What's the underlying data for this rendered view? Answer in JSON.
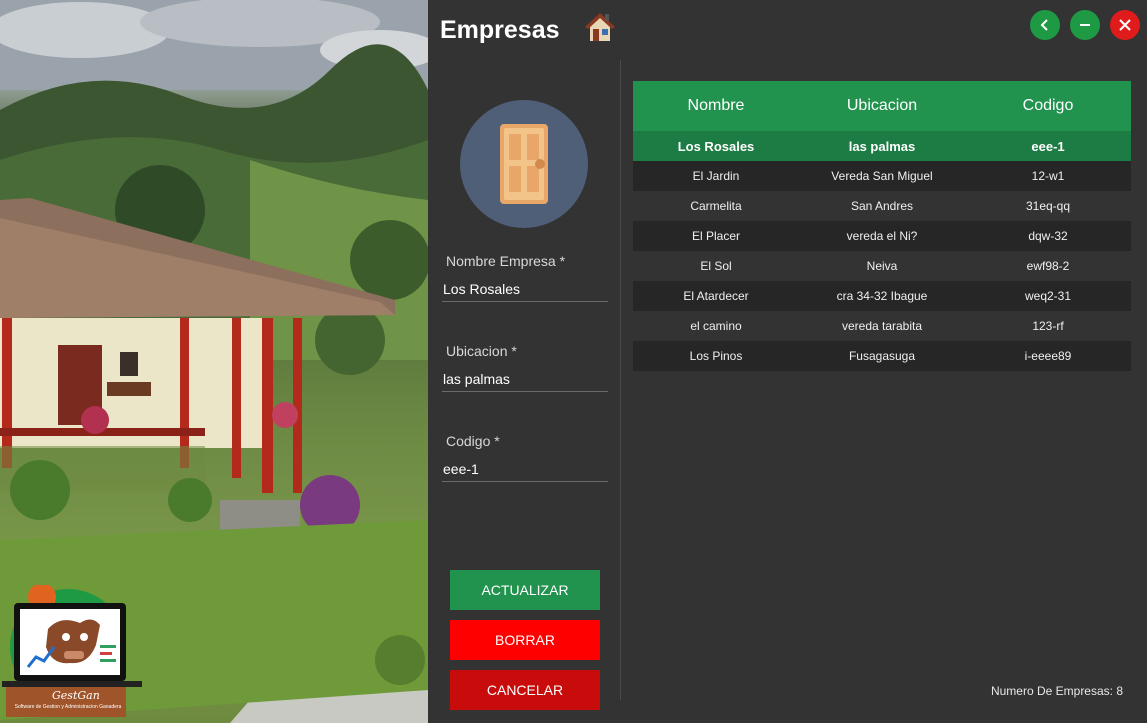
{
  "window": {
    "title": "Empresas",
    "title_icon": "house-icon",
    "buttons": [
      "back-icon",
      "minimize-icon",
      "close-icon"
    ]
  },
  "colors": {
    "background": "#333333",
    "accent_green": "#21934e",
    "selected_row": "#1d7c43",
    "delete_red": "#ff0000",
    "cancel_red": "#c80c0c"
  },
  "form": {
    "avatar_icon": "door-icon",
    "fields": [
      {
        "label": "Nombre Empresa *",
        "value": "Los Rosales"
      },
      {
        "label": "Ubicacion *",
        "value": "las palmas"
      },
      {
        "label": "Codigo *",
        "value": "eee-1"
      }
    ],
    "buttons": {
      "update": "ACTUALIZAR",
      "delete": "BORRAR",
      "cancel": "CANCELAR"
    }
  },
  "table": {
    "headers": [
      "Nombre",
      "Ubicacion",
      "Codigo"
    ],
    "selected_index": 0,
    "rows": [
      [
        "Los Rosales",
        "las palmas",
        "eee-1"
      ],
      [
        "El Jardin",
        "Vereda San Miguel",
        "12-w1"
      ],
      [
        "Carmelita",
        "San Andres",
        "31eq-qq"
      ],
      [
        "El Placer",
        "vereda el Ni?",
        "dqw-32"
      ],
      [
        "El Sol",
        "Neiva",
        "ewf98-2"
      ],
      [
        "El Atardecer",
        "cra 34-32 Ibague",
        "weq2-31"
      ],
      [
        "el camino",
        "vereda tarabita",
        "123-rf"
      ],
      [
        "Los Pinos",
        "Fusagasuga",
        "i-eeee89"
      ]
    ]
  },
  "footer": {
    "count_text": "Numero De Empresas: 8"
  },
  "logo": {
    "name": "GestGan",
    "tagline": "Software de Gestion y Administracion Ganadera"
  }
}
